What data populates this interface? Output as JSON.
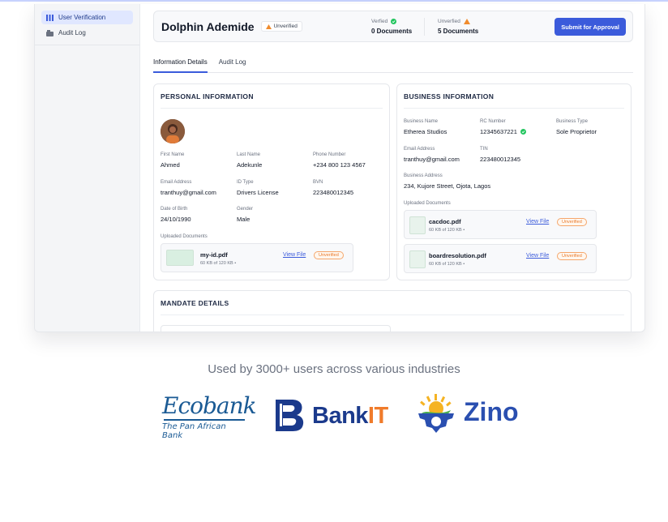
{
  "sidebar": {
    "items": [
      {
        "label": "User Verification",
        "icon": "grid-icon",
        "active": true
      },
      {
        "label": "Audit Log",
        "icon": "folder-icon",
        "active": false
      }
    ]
  },
  "header": {
    "name": "Dolphin Ademide",
    "status_badge": "Unverified",
    "verified": {
      "label": "Verfied",
      "value": "0 Documents"
    },
    "unverified": {
      "label": "Unverfied",
      "value": "5 Documents"
    },
    "submit_label": "Submit for Approval"
  },
  "tabs": [
    {
      "label": "Information Details",
      "active": true
    },
    {
      "label": "Audit Log",
      "active": false
    }
  ],
  "personal": {
    "title": "PERSONAL INFORMATION",
    "first_name": {
      "label": "First Name",
      "value": "Ahmed"
    },
    "last_name": {
      "label": "Last Name",
      "value": "Adekunle"
    },
    "phone": {
      "label": "Phone Number",
      "value": "+234 800 123 4567"
    },
    "email": {
      "label": "Email Address",
      "value": "tranthuy@gmail.com"
    },
    "id_type": {
      "label": "ID Type",
      "value": "Drivers  License"
    },
    "bvn": {
      "label": "BVN",
      "value": "223480012345"
    },
    "dob": {
      "label": "Date of Birth",
      "value": "24/10/1990"
    },
    "gender": {
      "label": "Gender",
      "value": "Male"
    },
    "uploaded_label": "Uploaded Documents",
    "doc": {
      "name": "my-id.pdf",
      "size": "60 KB of 120 KB  •",
      "link": "View File",
      "status": "Unverified"
    }
  },
  "business": {
    "title": "BUSINESS INFORMATION",
    "name": {
      "label": "Business Name",
      "value": "Etherea Studios"
    },
    "rc": {
      "label": "RC Number",
      "value": "12345637221"
    },
    "type": {
      "label": "Business Type",
      "value": "Sole Proprietor"
    },
    "email": {
      "label": "Email Address",
      "value": "tranthuy@gmail.com"
    },
    "tin": {
      "label": "TIN",
      "value": "223480012345"
    },
    "address": {
      "label": "Business Address",
      "value": "234, Kujore Street, Ojota, Lagos"
    },
    "uploaded_label": "Uploaded Documents",
    "docs": [
      {
        "name": "cacdoc.pdf",
        "size": "60 KB of 120 KB  •",
        "link": "View File",
        "status": "Unverified"
      },
      {
        "name": "boardresolution.pdf",
        "size": "60 KB of 120 KB  •",
        "link": "View File",
        "status": "Unverified"
      }
    ]
  },
  "mandate": {
    "title": "MANDATE DETAILS"
  },
  "tagline": "Used by 3000+ users across various industries",
  "logos": [
    {
      "name": "Ecobank",
      "tagline": "The Pan African Bank",
      "color": "#1a5a94"
    },
    {
      "name": "Bank",
      "accent": "IT",
      "color": "#1b3a8c",
      "accent_color": "#f07b2b"
    },
    {
      "name": "Zino",
      "color": "#2a4fb0",
      "accent_color": "#f5b323"
    }
  ],
  "colors": {
    "primary": "#3b5bdb",
    "warning": "#f08c2e",
    "success": "#22c55e"
  }
}
